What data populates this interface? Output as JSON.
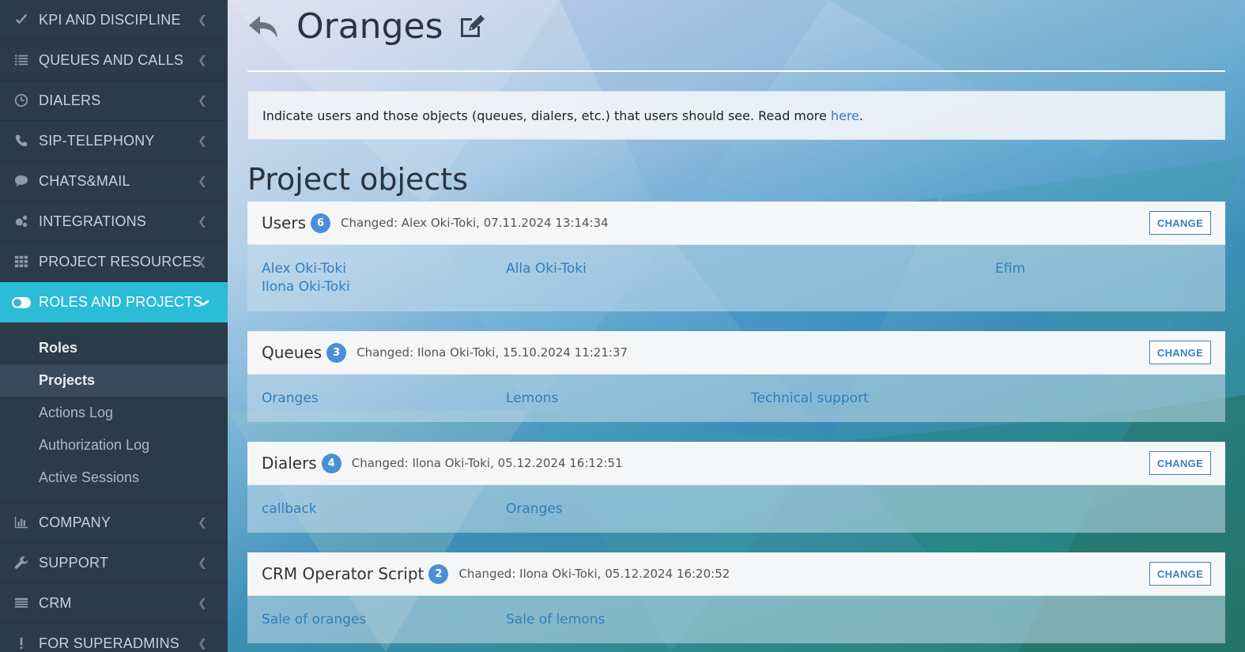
{
  "sidebar": {
    "items": [
      {
        "label": "KPI AND DISCIPLINE",
        "icon": "check-icon"
      },
      {
        "label": "QUEUES AND CALLS",
        "icon": "list-icon"
      },
      {
        "label": "DIALERS",
        "icon": "clock-icon"
      },
      {
        "label": "SIP-TELEPHONY",
        "icon": "phone-icon"
      },
      {
        "label": "CHATS&MAIL",
        "icon": "chat-icon"
      },
      {
        "label": "INTEGRATIONS",
        "icon": "gears-icon"
      },
      {
        "label": "PROJECT RESOURCES",
        "icon": "grid-icon"
      },
      {
        "label": "ROLES AND PROJECTS",
        "icon": "toggle-icon"
      }
    ],
    "submenu": [
      {
        "label": "Roles"
      },
      {
        "label": "Projects"
      },
      {
        "label": "Actions Log"
      },
      {
        "label": "Authorization Log"
      },
      {
        "label": "Active Sessions"
      }
    ],
    "bottom_items": [
      {
        "label": "COMPANY",
        "icon": "bar-chart-icon"
      },
      {
        "label": "SUPPORT",
        "icon": "wrench-icon"
      },
      {
        "label": "CRM",
        "icon": "table-icon"
      },
      {
        "label": "FOR SUPERADMINS",
        "icon": "exclamation-icon"
      }
    ],
    "active_color": "#2bbcd6"
  },
  "header": {
    "title": "Oranges"
  },
  "info": {
    "text": "Indicate users and those objects (queues, dialers, etc.) that users should see. Read more ",
    "link": "here",
    "tail": "."
  },
  "section_title": "Project objects",
  "cards": [
    {
      "name": "Users",
      "count": "6",
      "changed": "Changed: Alex Oki-Toki, 07.11.2024 13:14:34",
      "button": "CHANGE",
      "items": [
        "Alex Oki-Toki",
        "Alla Oki-Toki",
        "Efim",
        "Ilona Oki-Toki"
      ]
    },
    {
      "name": "Queues",
      "count": "3",
      "changed": "Changed: Ilona Oki-Toki, 15.10.2024 11:21:37",
      "button": "CHANGE",
      "items": [
        "Oranges",
        "Lemons",
        "Technical support"
      ]
    },
    {
      "name": "Dialers",
      "count": "4",
      "changed": "Changed: Ilona Oki-Toki, 05.12.2024 16:12:51",
      "button": "CHANGE",
      "items": [
        "callback",
        "Oranges"
      ]
    },
    {
      "name": "CRM Operator Script",
      "count": "2",
      "changed": "Changed: Ilona Oki-Toki, 05.12.2024 16:20:52",
      "button": "CHANGE",
      "items": [
        "Sale of oranges",
        "Sale of lemons"
      ]
    }
  ]
}
